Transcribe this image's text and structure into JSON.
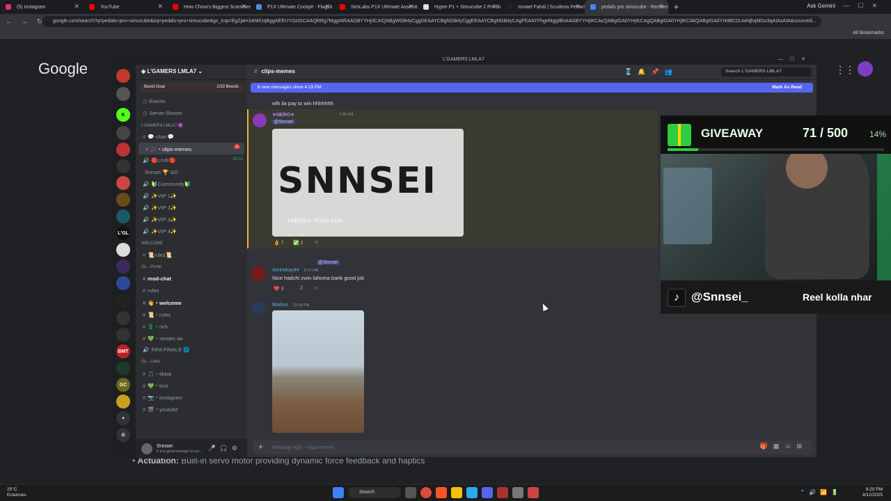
{
  "browser": {
    "tabs": [
      {
        "label": "(5) Instagram",
        "color": "#e1306c"
      },
      {
        "label": "YouTube",
        "color": "#ff0000"
      },
      {
        "label": "How China's Biggest Scammer...",
        "color": "#ff0000"
      },
      {
        "label": "P1X Ultimate Cockpit - Flagsh...",
        "color": "#4a90d9"
      },
      {
        "label": "SimLabs P1X Ultimate Assemb...",
        "color": "#ff0000"
      },
      {
        "label": "Hyper P1 + Simucube 2 Pro Bu...",
        "color": "#dddddd"
      },
      {
        "label": "Ismael Fahdi | Scuderia Ferrari...",
        "color": "#222222"
      },
      {
        "label": "pedals pro simucube - Recherch...",
        "color": "#4285f4"
      }
    ],
    "ask": "Ask Gemini",
    "url": "google.com/search?q=pedals+pro+simucube&oq=pedals+pro+simucube&gs_lcrp=EgZjaHJvbWUqBggAEEUYOzIGCAAQRRg7MggIARAAGBYYHjIICAIQABgWGB4yCggDEAAYCBgNGB4yCggEEAAYCBgNGB4yCAgFEAAYFhgeMggIBhAAGBYYHjIKCAcQABgIGA0YHjIKCAgQABgIGA0YHjIKCAkQABgIGA0YHtIBCDUwNjhqMGo3qAIAsAIA&sourceid...",
    "bookmarks": "All Bookmarks"
  },
  "google": {
    "logo": "Google",
    "snippet_label": "Actuation:",
    "snippet_text": " Built-in servo motor providing dynamic force feedback and haptics"
  },
  "discord": {
    "window_title": "L'GAMERS LMLA7",
    "server_name": "L'GAMERS LMLA7",
    "boost_goal": "Boost Goal",
    "boost_count": "2/33 Boosts",
    "channels": [
      {
        "label": "Events",
        "type": "menu"
      },
      {
        "label": "Server Boosts",
        "type": "menu"
      },
      {
        "label": "L'GAMERS LMLA7 🟣",
        "type": "category"
      },
      {
        "label": "💬-chat-💬",
        "type": "text"
      },
      {
        "label": "🎥・clips-memes",
        "type": "text",
        "selected": true,
        "badge": "1"
      },
      {
        "label": "🔴LIVE🔴",
        "type": "voice",
        "time": "36:53"
      },
      {
        "label": "Snnsei  🏆 GG",
        "type": "member"
      },
      {
        "label": "🔰Community🔰",
        "type": "voice"
      },
      {
        "label": "✨VIP 1✨",
        "type": "voice"
      },
      {
        "label": "✨VIP 2✨",
        "type": "voice"
      },
      {
        "label": "✨VIP 3✨",
        "type": "voice"
      },
      {
        "label": "✨VIP 4✨",
        "type": "voice"
      },
      {
        "label": "WELCOME",
        "type": "category"
      },
      {
        "label": "📜rules📜",
        "type": "text"
      },
      {
        "label": "GL - Portal",
        "type": "category"
      },
      {
        "label": "mod-chat",
        "type": "text",
        "bold": true
      },
      {
        "label": "rules",
        "type": "text"
      },
      {
        "label": "👋・welcome",
        "type": "text",
        "bold": true
      },
      {
        "label": "📜・rules",
        "type": "text"
      },
      {
        "label": "💲・rich",
        "type": "text"
      },
      {
        "label": "💚・stream ᴏɴ",
        "type": "text"
      },
      {
        "label": "FIFA FINALE 🌐",
        "type": "voice"
      },
      {
        "label": "GL - Links",
        "type": "category"
      },
      {
        "label": "🎵・tiktok",
        "type": "text"
      },
      {
        "label": "💚・kick",
        "type": "text"
      },
      {
        "label": "📷・instagram",
        "type": "text"
      },
      {
        "label": "🎬・youtube",
        "type": "text"
      }
    ],
    "user": {
      "name": "Snnsei",
      "status": "If it is good enough to scr..."
    },
    "channel_title": "clips-memes",
    "search_placeholder": "Search L'GAMERS LMLA7",
    "new_messages": "8 new messages since 4:19 PM",
    "mark_as_read": "Mark As Read",
    "messages": [
      {
        "text": "wlh ila pay to win hhhhhhh"
      },
      {
        "author": "✦NERO✦",
        "time": "7:35 PM",
        "mention": "@Snnsei",
        "image_text": "SNNSEI",
        "image_sub": "✦NERO✦ TEAM KUN",
        "reactions": [
          {
            "emoji": "👌",
            "count": "7"
          },
          {
            "emoji": "✅",
            "count": "2"
          }
        ]
      },
      {
        "reply_to": "@Snnsei",
        "author": "Aminekay44",
        "time": "8:17 PM",
        "text": "Nice hadchi zwin lahoma barik good job",
        "reactions": [
          {
            "emoji": "❤️",
            "count": "3"
          },
          {
            "emoji": "",
            "count": "2"
          }
        ]
      },
      {
        "author": "Markos",
        "time": "11:18 PM"
      }
    ],
    "composer_placeholder": "Message #🎥・clips-memes"
  },
  "overlay": {
    "giveaway_label": "GIVEAWAY",
    "count": "71 / 500",
    "percent": "14%",
    "progress": 0.14,
    "handle": "@Snnsei_",
    "tagline": "Reel kolla nhar"
  },
  "taskbar": {
    "temp": "25°C",
    "weather": "Eclaircies",
    "search": "Search",
    "time": "9:20 PM",
    "date": "8/12/2025"
  }
}
